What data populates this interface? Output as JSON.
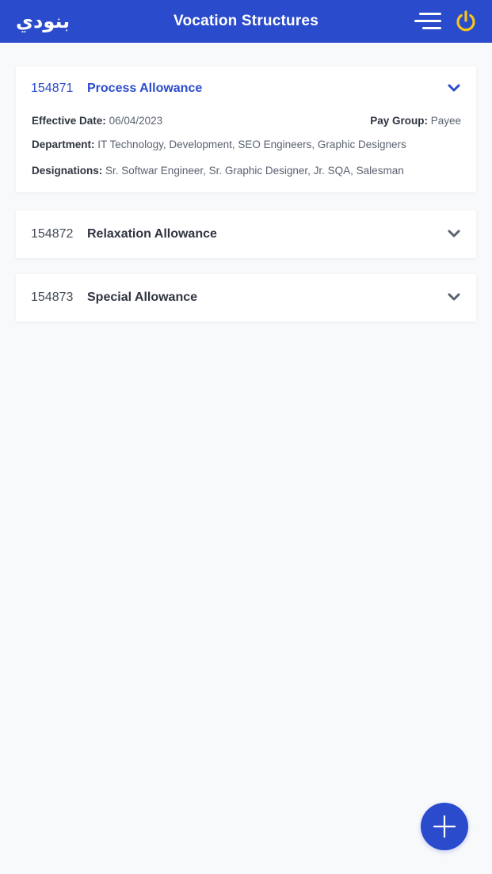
{
  "header": {
    "logo_text": "بنودي",
    "title": "Vocation Structures",
    "menu_icon": "hamburger-menu-icon",
    "power_icon": "power-icon"
  },
  "colors": {
    "primary": "#2b4bcd",
    "power": "#f5c518",
    "background": "#f8f9fb"
  },
  "structures": [
    {
      "id": "154871",
      "name": "Process Allowance",
      "expanded": true,
      "effective_date_label": "Effective Date:",
      "effective_date": "06/04/2023",
      "pay_group_label": "Pay Group:",
      "pay_group": "Payee",
      "department_label": "Department:",
      "department": "IT Technology, Development, SEO Engineers, Graphic Designers",
      "designations_label": "Designations:",
      "designations": "Sr. Softwar Engineer, Sr. Graphic Designer, Jr. SQA, Salesman"
    },
    {
      "id": "154872",
      "name": "Relaxation Allowance",
      "expanded": false
    },
    {
      "id": "154873",
      "name": "Special Allowance",
      "expanded": false
    }
  ],
  "fab": {
    "icon": "plus-icon"
  }
}
